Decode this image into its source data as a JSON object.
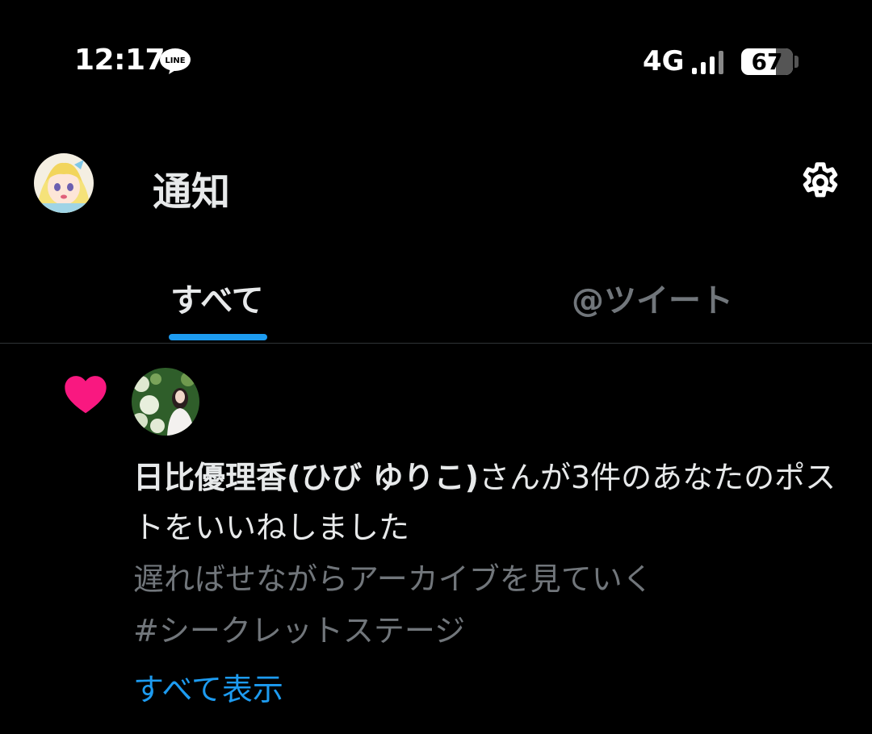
{
  "status_bar": {
    "time": "12:17",
    "line_badge": "LINE",
    "network": "4G",
    "battery": "67",
    "battery_level": 0.67
  },
  "header": {
    "title": "通知",
    "settings_icon": "gear-icon"
  },
  "tabs": [
    {
      "label": "すべて",
      "selected": true
    },
    {
      "label": "@ツイート",
      "selected": false
    }
  ],
  "notification": {
    "icon": "heart-icon",
    "icon_color": "#f91880",
    "actor_name": "日比優理香(ひび ゆりこ)",
    "action": "さんが3件のあなたのポストをいいねしました",
    "post_text": "遅ればせながらアーカイブを見ていく\n#シークレットステージ",
    "show_all": "すべて表示"
  },
  "colors": {
    "background": "#000000",
    "text_primary": "#e7e9ea",
    "text_secondary": "#71767b",
    "accent": "#1d9bf0",
    "like": "#f91880"
  }
}
